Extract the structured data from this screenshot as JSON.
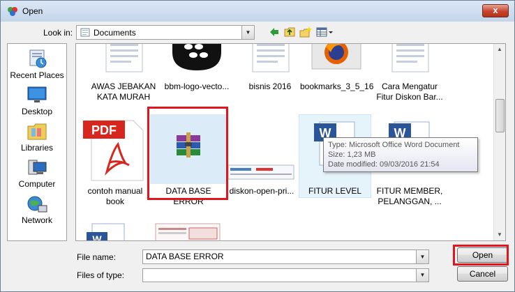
{
  "window": {
    "title": "Open",
    "close_glyph": "x"
  },
  "toolbar": {
    "look_in_label": "Look in:",
    "look_in_value": "Documents",
    "icons": [
      "back-arrow-icon",
      "up-folder-icon",
      "new-folder-icon",
      "view-menu-icon"
    ]
  },
  "places": [
    {
      "label": "Recent Places",
      "icon": "recent-places-icon"
    },
    {
      "label": "Desktop",
      "icon": "desktop-icon"
    },
    {
      "label": "Libraries",
      "icon": "libraries-icon"
    },
    {
      "label": "Computer",
      "icon": "computer-icon"
    },
    {
      "label": "Network",
      "icon": "network-icon"
    }
  ],
  "files": [
    {
      "name": "AWAS JEBAKAN\nKATA MURAH",
      "icon": "document-icon"
    },
    {
      "name": "bbm-logo-vecto...",
      "icon": "bbm-logo-icon"
    },
    {
      "name": "bisnis 2016",
      "icon": "document-icon"
    },
    {
      "name": "bookmarks_3_5_16",
      "icon": "firefox-icon"
    },
    {
      "name": "Cara Mengatur\nFitur Diskon Bar...",
      "icon": "document-icon"
    },
    {
      "name": "contoh manual\nbook",
      "icon": "pdf-icon"
    },
    {
      "name": "DATA BASE ERROR",
      "icon": "winrar-archive-icon"
    },
    {
      "name": "diskon-open-pri...",
      "icon": "image-thumbnail-icon"
    },
    {
      "name": "FITUR LEVEL",
      "icon": "word-document-icon"
    },
    {
      "name": "FITUR MEMBER,\nPELANGGAN, ...",
      "icon": "word-document-icon"
    },
    {
      "name": "",
      "icon": "word-document-icon"
    },
    {
      "name": "",
      "icon": "image-thumbnail-icon"
    }
  ],
  "tooltip": {
    "type": "Type: Microsoft Office Word Document",
    "size": "Size: 1,23 MB",
    "modified": "Date modified: 09/03/2016 21:54"
  },
  "bottom": {
    "file_name_label": "File name:",
    "file_name_value": "DATA BASE ERROR",
    "file_type_label": "Files of type:",
    "file_type_value": "",
    "open_label": "Open",
    "cancel_label": "Cancel"
  },
  "colors": {
    "highlight_red": "#e0161c",
    "hover_blue": "#e5f3fb",
    "word_blue": "#2a5699",
    "pdf_red": "#d7261d"
  }
}
